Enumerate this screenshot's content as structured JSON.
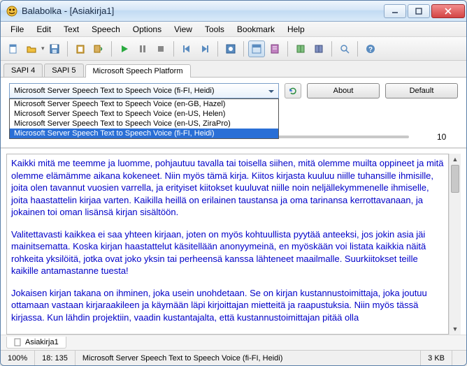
{
  "title": "Balabolka - [Asiakirja1]",
  "menu": [
    "File",
    "Edit",
    "Text",
    "Speech",
    "Options",
    "View",
    "Tools",
    "Bookmark",
    "Help"
  ],
  "tabs": {
    "sapi4": "SAPI 4",
    "sapi5": "SAPI 5",
    "msp": "Microsoft Speech Platform"
  },
  "voice": {
    "selected": "Microsoft Server Speech Text to Speech Voice (fi-FI, Heidi)",
    "options": [
      "Microsoft Server Speech Text to Speech Voice (en-GB, Hazel)",
      "Microsoft Server Speech Text to Speech Voice (en-US, Helen)",
      "Microsoft Server Speech Text to Speech Voice (en-US, ZiraPro)",
      "Microsoft Server Speech Text to Speech Voice (fi-FI, Heidi)"
    ]
  },
  "buttons": {
    "about": "About",
    "default": "Default"
  },
  "slider_value": "10",
  "document": {
    "p1": "Kaikki mitä me teemme ja luomme, pohjautuu tavalla tai toisella siihen, mitä olemme muilta oppineet ja mitä olemme elämämme aikana kokeneet. Niin myös tämä kirja. Kiitos kirjasta kuuluu niille tuhansille ihmisille, joita olen tavannut vuosien varrella, ja erityiset kiitokset kuuluvat niille noin neljällekymmenelle ihmiselle, joita haastattelin kirjaa varten. Kaikilla heillä on erilainen taustansa ja oma tarinansa kerrottavanaan, ja jokainen toi oman lisänsä kirjan sisältöön.",
    "p2": "Valitettavasti kaikkea ei saa yhteen kirjaan, joten on myös kohtuullista pyytää anteeksi, jos jokin asia jäi mainitsematta. Koska kirjan haastattelut käsitellään anonyymeinä, en myöskään voi listata kaikkia näitä rohkeita yksilöitä, jotka ovat joko yksin tai perheensä kanssa lähteneet maailmalle. Suurkiitokset teille kaikille antamastanne tuesta!",
    "p3": "Jokaisen kirjan takana on ihminen, joka usein unohdetaan. Se on kirjan kustannustoimittaja, joka joutuu ottamaan vastaan kirjaraakileen ja käymään läpi kirjoittajan mietteitä ja raapustuksia. Niin myös tässä kirjassa. Kun lähdin projektiin, vaadin kustantajalta, että kustannustoimittajan pitää olla"
  },
  "doc_tab": "Asiakirja1",
  "status": {
    "zoom": "100%",
    "pos": "18: 135",
    "voice": "Microsoft Server Speech Text to Speech Voice (fi-FI, Heidi)",
    "size": "3 KB"
  }
}
